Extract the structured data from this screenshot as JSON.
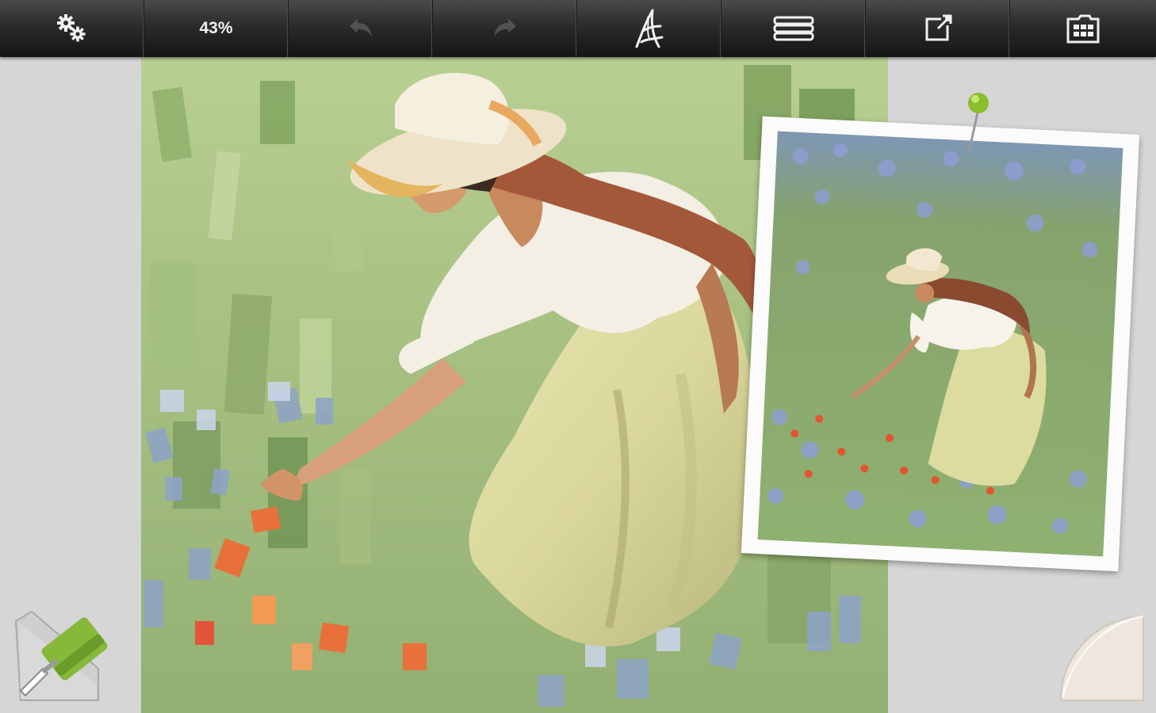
{
  "toolbar": {
    "zoom_label": "43%",
    "buttons": [
      {
        "icon": "gears-icon"
      },
      {
        "icon": "zoom-level"
      },
      {
        "icon": "undo-icon",
        "enabled": false
      },
      {
        "icon": "redo-icon",
        "enabled": false
      },
      {
        "icon": "brush-style-icon"
      },
      {
        "icon": "layers-icon"
      },
      {
        "icon": "share-icon"
      },
      {
        "icon": "gallery-icon"
      }
    ]
  },
  "canvas": {
    "content": "painting"
  },
  "reference": {
    "content": "photo"
  },
  "tools": {
    "brush_icon": "brush-icon",
    "brush_color": "#86b83a",
    "page_curl_icon": "page-curl-icon"
  }
}
